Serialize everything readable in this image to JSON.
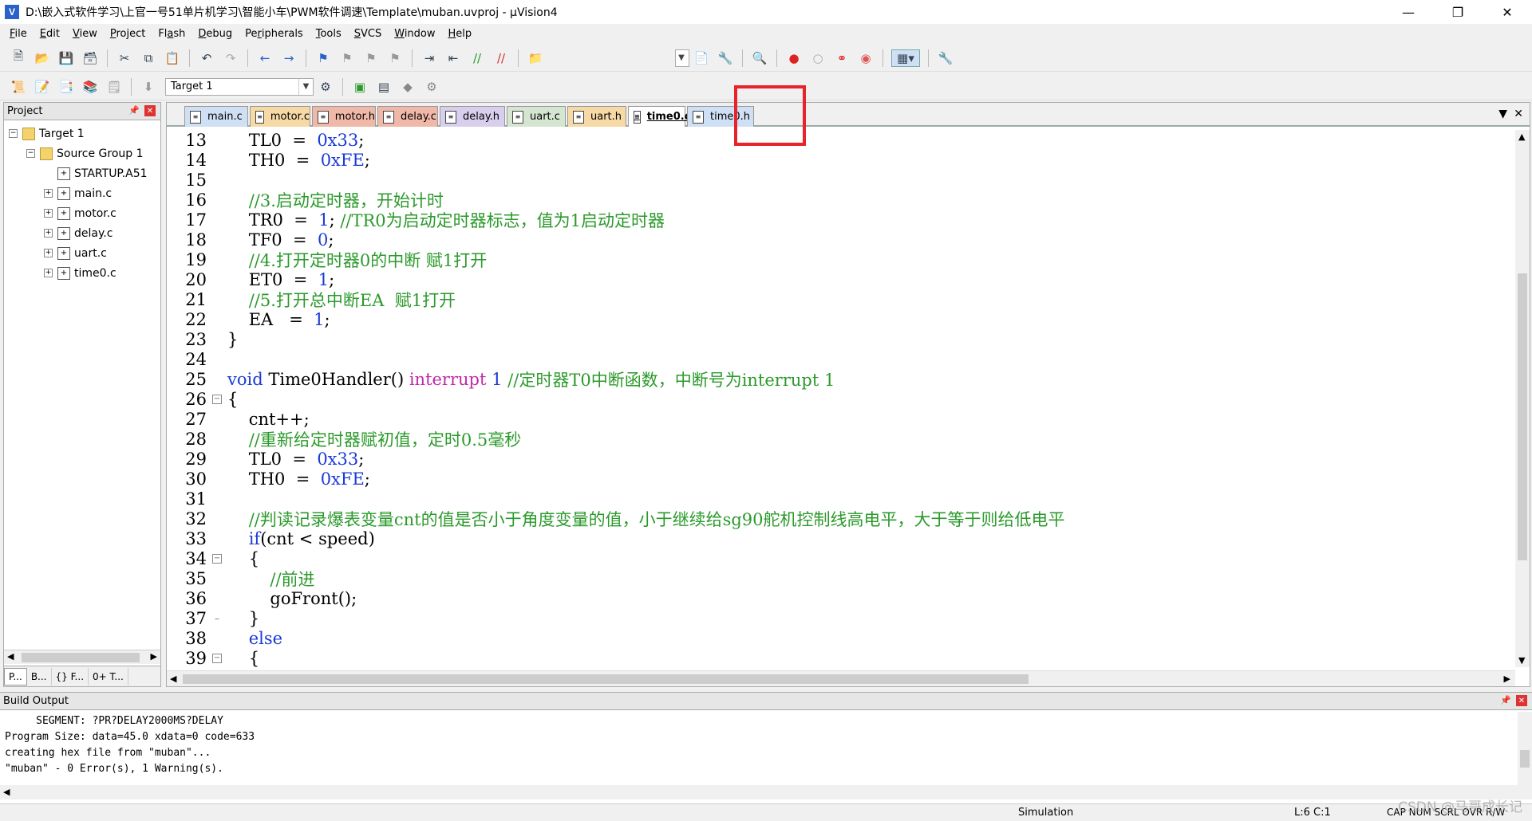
{
  "window": {
    "title": "D:\\嵌入式软件学习\\上官一号51单片机学习\\智能小车\\PWM软件调速\\Template\\muban.uvproj - µVision4",
    "app_icon_letter": "V"
  },
  "menu": [
    {
      "pre": "",
      "u": "F",
      "post": "ile"
    },
    {
      "pre": "",
      "u": "E",
      "post": "dit"
    },
    {
      "pre": "",
      "u": "V",
      "post": "iew"
    },
    {
      "pre": "",
      "u": "P",
      "post": "roject"
    },
    {
      "pre": "Fl",
      "u": "a",
      "post": "sh"
    },
    {
      "pre": "",
      "u": "D",
      "post": "ebug"
    },
    {
      "pre": "Pe",
      "u": "r",
      "post": "ipherals"
    },
    {
      "pre": "",
      "u": "T",
      "post": "ools"
    },
    {
      "pre": "",
      "u": "S",
      "post": "VCS"
    },
    {
      "pre": "",
      "u": "W",
      "post": "indow"
    },
    {
      "pre": "",
      "u": "H",
      "post": "elp"
    }
  ],
  "target_combo": {
    "value": "Target 1"
  },
  "project_panel": {
    "title": "Project",
    "tree": [
      {
        "label": "Target 1",
        "level": 0,
        "exp": "−",
        "kind": "target"
      },
      {
        "label": "Source Group 1",
        "level": 1,
        "exp": "−",
        "kind": "folder"
      },
      {
        "label": "STARTUP.A51",
        "level": 2,
        "exp": "",
        "kind": "file"
      },
      {
        "label": "main.c",
        "level": 2,
        "exp": "+",
        "kind": "file"
      },
      {
        "label": "motor.c",
        "level": 2,
        "exp": "+",
        "kind": "file"
      },
      {
        "label": "delay.c",
        "level": 2,
        "exp": "+",
        "kind": "file"
      },
      {
        "label": "uart.c",
        "level": 2,
        "exp": "+",
        "kind": "file"
      },
      {
        "label": "time0.c",
        "level": 2,
        "exp": "+",
        "kind": "file"
      }
    ],
    "bottom_tabs": [
      "P...",
      "B...",
      "{} F...",
      "0+ T..."
    ]
  },
  "file_tabs": [
    {
      "label": "main.c",
      "style": "main"
    },
    {
      "label": "motor.c",
      "style": "c"
    },
    {
      "label": "motor.h",
      "style": "h"
    },
    {
      "label": "delay.c",
      "style": "h"
    },
    {
      "label": "delay.h",
      "style": "delayh"
    },
    {
      "label": "uart.c",
      "style": "uartc"
    },
    {
      "label": "uart.h",
      "style": "c"
    },
    {
      "label": "time0.c",
      "style": "active"
    },
    {
      "label": "time0.h",
      "style": "time0h"
    }
  ],
  "code_lines": [
    {
      "n": "13",
      "fold": "",
      "parts": [
        [
          "tx",
          "    TL0  =  "
        ],
        [
          "num",
          "0x33"
        ],
        [
          "tx",
          ";"
        ]
      ]
    },
    {
      "n": "14",
      "fold": "",
      "parts": [
        [
          "tx",
          "    TH0  =  "
        ],
        [
          "num",
          "0xFE"
        ],
        [
          "tx",
          ";"
        ]
      ]
    },
    {
      "n": "15",
      "fold": "",
      "parts": []
    },
    {
      "n": "16",
      "fold": "",
      "parts": [
        [
          "cm",
          "    //3.启动定时器，开始计时"
        ]
      ]
    },
    {
      "n": "17",
      "fold": "",
      "parts": [
        [
          "tx",
          "    TR0  =  "
        ],
        [
          "num",
          "1"
        ],
        [
          "tx",
          "; "
        ],
        [
          "cm",
          "//TR0为启动定时器标志，值为1启动定时器"
        ]
      ]
    },
    {
      "n": "18",
      "fold": "",
      "parts": [
        [
          "tx",
          "    TF0  =  "
        ],
        [
          "num",
          "0"
        ],
        [
          "tx",
          ";"
        ]
      ]
    },
    {
      "n": "19",
      "fold": "",
      "parts": [
        [
          "cm",
          "    //4.打开定时器0的中断 赋1打开"
        ]
      ]
    },
    {
      "n": "20",
      "fold": "",
      "parts": [
        [
          "tx",
          "    ET0  =  "
        ],
        [
          "num",
          "1"
        ],
        [
          "tx",
          ";"
        ]
      ]
    },
    {
      "n": "21",
      "fold": "",
      "parts": [
        [
          "cm",
          "    //5.打开总中断EA  赋1打开"
        ]
      ]
    },
    {
      "n": "22",
      "fold": "",
      "parts": [
        [
          "tx",
          "    EA   =  "
        ],
        [
          "num",
          "1"
        ],
        [
          "tx",
          ";"
        ]
      ]
    },
    {
      "n": "23",
      "fold": "",
      "parts": [
        [
          "tx",
          "}"
        ]
      ]
    },
    {
      "n": "24",
      "fold": "",
      "parts": []
    },
    {
      "n": "25",
      "fold": "",
      "parts": [
        [
          "kw",
          "void"
        ],
        [
          "tx",
          " Time0Handler() "
        ],
        [
          "ir",
          "interrupt"
        ],
        [
          "tx",
          " "
        ],
        [
          "num",
          "1"
        ],
        [
          "tx",
          " "
        ],
        [
          "cm",
          "//定时器T0中断函数，中断号为interrupt 1"
        ]
      ]
    },
    {
      "n": "26",
      "fold": "box",
      "parts": [
        [
          "tx",
          "{"
        ]
      ]
    },
    {
      "n": "27",
      "fold": "",
      "parts": [
        [
          "tx",
          "    cnt++;"
        ]
      ]
    },
    {
      "n": "28",
      "fold": "",
      "parts": [
        [
          "cm",
          "    //重新给定时器赋初值，定时0.5毫秒"
        ]
      ]
    },
    {
      "n": "29",
      "fold": "",
      "parts": [
        [
          "tx",
          "    TL0  =  "
        ],
        [
          "num",
          "0x33"
        ],
        [
          "tx",
          ";"
        ]
      ]
    },
    {
      "n": "30",
      "fold": "",
      "parts": [
        [
          "tx",
          "    TH0  =  "
        ],
        [
          "num",
          "0xFE"
        ],
        [
          "tx",
          ";"
        ]
      ]
    },
    {
      "n": "31",
      "fold": "",
      "parts": []
    },
    {
      "n": "32",
      "fold": "",
      "parts": [
        [
          "cm",
          "    //判读记录爆表变量cnt的值是否小于角度变量的值，小于继续给sg90舵机控制线高电平，大于等于则给低电平"
        ]
      ]
    },
    {
      "n": "33",
      "fold": "",
      "parts": [
        [
          "tx",
          "    "
        ],
        [
          "kw",
          "if"
        ],
        [
          "tx",
          "(cnt < speed)"
        ]
      ]
    },
    {
      "n": "34",
      "fold": "box",
      "parts": [
        [
          "tx",
          "    {"
        ]
      ]
    },
    {
      "n": "35",
      "fold": "",
      "parts": [
        [
          "cm",
          "        //前进"
        ]
      ]
    },
    {
      "n": "36",
      "fold": "",
      "parts": [
        [
          "tx",
          "        goFront();"
        ]
      ]
    },
    {
      "n": "37",
      "fold": "end",
      "parts": [
        [
          "tx",
          "    }"
        ]
      ]
    },
    {
      "n": "38",
      "fold": "",
      "parts": [
        [
          "tx",
          "    "
        ],
        [
          "kw",
          "else"
        ]
      ]
    },
    {
      "n": "39",
      "fold": "box",
      "parts": [
        [
          "tx",
          "    {"
        ]
      ]
    }
  ],
  "build_output": {
    "title": "Build Output",
    "lines": [
      "     SEGMENT: ?PR?DELAY2000MS?DELAY",
      "Program Size: data=45.0 xdata=0 code=633",
      "creating hex file from \"muban\"...",
      "\"muban\" - 0 Error(s), 1 Warning(s)."
    ]
  },
  "status": {
    "mode": "Simulation",
    "position": "L:6 C:1",
    "indicators": "CAP  NUM  SCRL  OVR  R/W"
  },
  "watermark": "CSDN @马哥成长记",
  "colors": {
    "highlight": "#e8232a",
    "keyword": "#1a3ad6",
    "comment": "#2b9a2b",
    "interrupt": "#c02aa5"
  }
}
